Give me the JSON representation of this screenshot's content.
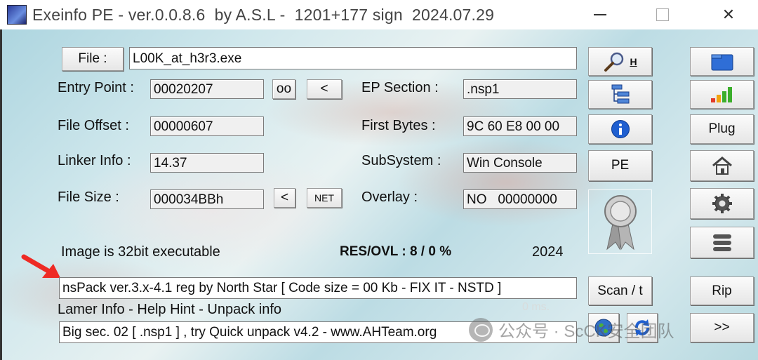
{
  "window": {
    "title": "Exeinfo PE - ver.0.0.8.6  by A.S.L -  1201+177 sign  2024.07.29",
    "controls": {
      "minimize_icon": "minimize-icon",
      "maximize_icon": "maximize-icon",
      "close_label": "✕"
    }
  },
  "file": {
    "button_label": "File :",
    "path": "L00K_at_h3r3.exe"
  },
  "fields": {
    "entry_point": {
      "label": "Entry Point :",
      "value": "00020207"
    },
    "file_offset": {
      "label": "File Offset :",
      "value": "00000607"
    },
    "linker_info": {
      "label": "Linker Info :",
      "value": "14.37"
    },
    "file_size": {
      "label": "File Size :",
      "value": "000034BBh"
    },
    "ep_section": {
      "label": "EP Section :",
      "value": ".nsp1"
    },
    "first_bytes": {
      "label": "First Bytes :",
      "value": "9C 60 E8 00 00"
    },
    "subsystem": {
      "label": "SubSystem :",
      "value": "Win Console"
    },
    "overlay": {
      "label": "Overlay :",
      "value": "NO   00000000"
    }
  },
  "small_buttons": {
    "oo": "oo",
    "ep_back": "<",
    "size_back": "<",
    "net": "NET"
  },
  "status": {
    "image_info": "Image is 32bit executable",
    "res_ovl": "RES/OVL : 8 / 0 %",
    "year": "2024",
    "detection": "nsPack ver.3.x-4.1 reg by North Star  [ Code size = 00 Kb - FIX IT - NSTD ]",
    "hint_links": "Lamer Info - Help Hint - Unpack info",
    "timing": "0 ms.",
    "unpack_hint": "Big sec. 02 [ .nsp1 ] , try Quick unpack v4.2 - www.AHTeam.org"
  },
  "right_buttons": {
    "search_label": "H",
    "pe_label": "PE",
    "scan_label": "Scan / t",
    "plug_label": "Plug",
    "rip_label": "Rip",
    "next_label": ">>"
  },
  "watermark": "公众号 · ScCK安全团队",
  "colors": {
    "arrow": "#ee2a24",
    "icon_blue": "#1f5fd0",
    "signal_red": "#e23b2a",
    "signal_orange": "#f2a20e",
    "signal_green": "#3cae2c"
  }
}
